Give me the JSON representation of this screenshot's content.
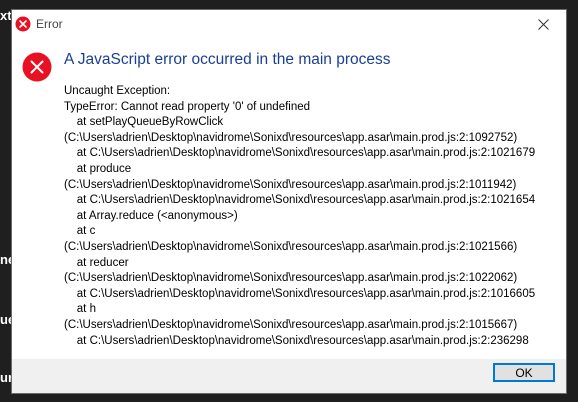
{
  "background": {
    "fragments": [
      "xt",
      "ne",
      "ue",
      "ur"
    ]
  },
  "dialog": {
    "title": "Error",
    "close_icon": "close-icon",
    "error_icon": "error-icon",
    "heading": "A JavaScript error occurred in the main process",
    "lines": [
      "Uncaught Exception:",
      "TypeError: Cannot read property '0' of undefined",
      "    at setPlayQueueByRowClick",
      "(C:\\Users\\adrien\\Desktop\\navidrome\\Sonixd\\resources\\app.asar\\main.prod.js:2:1092752)",
      "    at C:\\Users\\adrien\\Desktop\\navidrome\\Sonixd\\resources\\app.asar\\main.prod.js:2:1021679",
      "    at produce",
      "(C:\\Users\\adrien\\Desktop\\navidrome\\Sonixd\\resources\\app.asar\\main.prod.js:2:1011942)",
      "    at C:\\Users\\adrien\\Desktop\\navidrome\\Sonixd\\resources\\app.asar\\main.prod.js:2:1021654",
      "    at Array.reduce (<anonymous>)",
      "    at c",
      "(C:\\Users\\adrien\\Desktop\\navidrome\\Sonixd\\resources\\app.asar\\main.prod.js:2:1021566)",
      "    at reducer",
      "(C:\\Users\\adrien\\Desktop\\navidrome\\Sonixd\\resources\\app.asar\\main.prod.js:2:1022062)",
      "    at C:\\Users\\adrien\\Desktop\\navidrome\\Sonixd\\resources\\app.asar\\main.prod.js:2:1016605",
      "    at h",
      "(C:\\Users\\adrien\\Desktop\\navidrome\\Sonixd\\resources\\app.asar\\main.prod.js:2:1015667)",
      "    at C:\\Users\\adrien\\Desktop\\navidrome\\Sonixd\\resources\\app.asar\\main.prod.js:2:236298"
    ],
    "ok_label": "OK"
  },
  "colors": {
    "error_red": "#e81123",
    "heading_blue": "#1a3f8f",
    "button_accent": "#0078d7"
  }
}
